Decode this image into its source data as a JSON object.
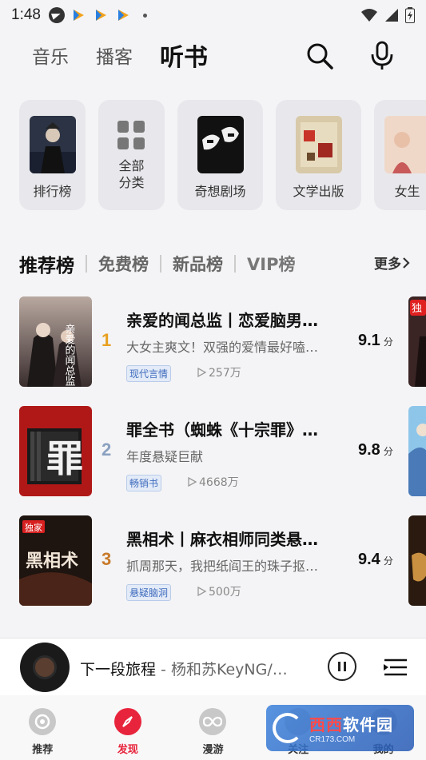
{
  "status_bar": {
    "time": "1:48"
  },
  "top_tabs": [
    {
      "label": "音乐",
      "active": false
    },
    {
      "label": "播客",
      "active": false
    },
    {
      "label": "听书",
      "active": true
    }
  ],
  "categories": [
    {
      "label": "排行榜"
    },
    {
      "label": "全部\n分类"
    },
    {
      "label": "奇想剧场"
    },
    {
      "label": "文学出版"
    },
    {
      "label": "女生"
    }
  ],
  "rank_tabs": [
    {
      "label": "推荐榜",
      "active": true
    },
    {
      "label": "免费榜",
      "active": false
    },
    {
      "label": "新品榜",
      "active": false
    },
    {
      "label": "VIP榜",
      "active": false
    }
  ],
  "more_label": "更多",
  "books": [
    {
      "rank": "1",
      "title": "亲爱的闻总监丨恋爱脑男…",
      "desc": "大女主爽文！双强的爱情最好嗑…",
      "tag": "现代言情",
      "plays": "257万",
      "score": "9.1",
      "score_unit": "分",
      "rank_color": "#e8a020"
    },
    {
      "rank": "2",
      "title": "罪全书（蜘蛛《十宗罪》…",
      "desc": "年度悬疑巨献",
      "tag": "畅销书",
      "plays": "4668万",
      "score": "9.8",
      "score_unit": "分",
      "rank_color": "#8aa0c0"
    },
    {
      "rank": "3",
      "title": "黑相术丨麻衣相师同类悬…",
      "desc": "抓周那天，我把纸阎王的珠子抠…",
      "tag": "悬疑脑洞",
      "plays": "500万",
      "score": "9.4",
      "score_unit": "分",
      "rank_color": "#c87a2a"
    }
  ],
  "cover_text": {
    "book1": "亲爱的闻总监",
    "book2": "罪",
    "book3_badge": "独家",
    "book3_title": "黑相术",
    "side_badge": "独"
  },
  "player": {
    "song": "下一段旅程",
    "artist": " - 杨和苏KeyNG/…"
  },
  "bottom_nav": [
    {
      "label": "推荐",
      "active": false
    },
    {
      "label": "发现",
      "active": true
    },
    {
      "label": "漫游",
      "active": false
    },
    {
      "label": "关注",
      "active": false
    },
    {
      "label": "我的",
      "active": false
    }
  ],
  "watermark": {
    "main_a": "西西",
    "main_b": "软件园",
    "sub": "CR173.COM"
  }
}
